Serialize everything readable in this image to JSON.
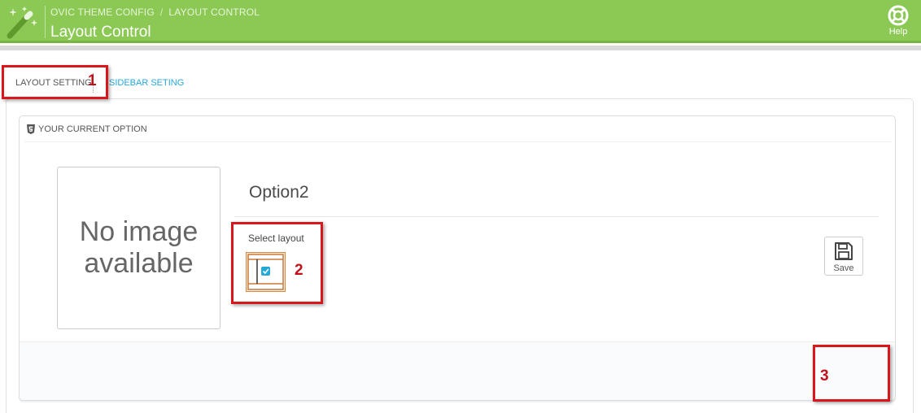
{
  "header": {
    "breadcrumb": [
      "OVIC THEME CONFIG",
      "LAYOUT CONTROL"
    ],
    "breadcrumb_separator": "/",
    "title": "Layout Control",
    "help_label": "Help",
    "logo_icon": "magic-wand-icon",
    "help_icon": "lifebuoy-icon"
  },
  "tabs": [
    {
      "label": "LAYOUT SETTING",
      "active": true
    },
    {
      "label": "SIDEBAR SETING",
      "active": false
    }
  ],
  "panel": {
    "title": "YOUR CURRENT OPTION",
    "title_icon": "html5-icon",
    "no_image_text": "No image available",
    "option_name": "Option2",
    "select_layout_label": "Select layout",
    "layout_icon": "layout-thumbnail-icon",
    "layout_selected": true
  },
  "footer": {
    "save_label": "Save",
    "save_icon": "floppy-disk-icon"
  },
  "annotations": [
    "1",
    "2",
    "3"
  ],
  "colors": {
    "header_bg": "#8bc954",
    "link": "#25a7d8",
    "annotation": "#d9161c",
    "layout_border": "#d9863a",
    "checkbox": "#25a7d8"
  }
}
